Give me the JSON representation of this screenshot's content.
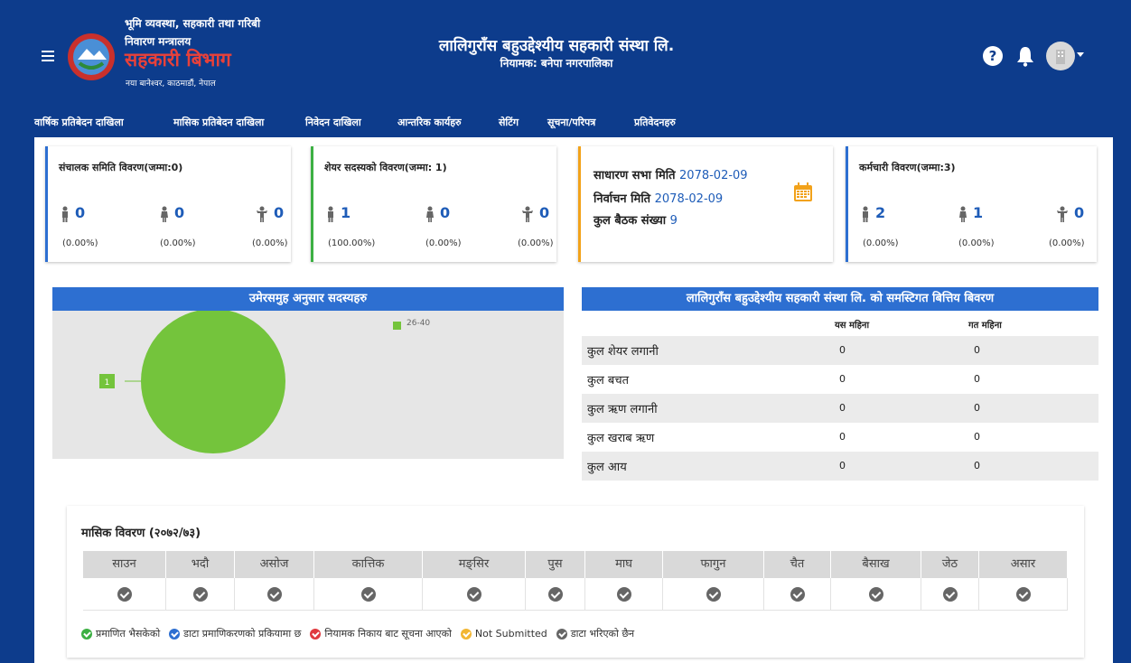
{
  "header": {
    "org_line1": "भूमि व्यवस्था, सहकारी तथा गरिबी",
    "org_line2": "निवारण मन्त्रालय",
    "org_name": "सहकारी बिभाग",
    "org_address": "नया बानेश्वर, काठमाडौं, नेपाल",
    "title": "लालिगुराँस बहुउद्देश्यीय सहकारी संस्था लि.",
    "subtitle": "नियामक: बनेपा नगरपालिका",
    "help_glyph": "?"
  },
  "nav": [
    {
      "label": "वार्षिक प्रतिबेदन दाखिला"
    },
    {
      "label": "मासिक प्रतिबेदन दाखिला"
    },
    {
      "label": "निवेदन दाखिला"
    },
    {
      "label": "आन्तरिक कार्यहरु"
    },
    {
      "label": "सेटिंग"
    },
    {
      "label": "सूचना/परिपत्र"
    },
    {
      "label": "प्रतिवेदनहरु"
    }
  ],
  "cards": {
    "board": {
      "title": "संचालक समिति विवरण(जम्मा:0)",
      "male": "0",
      "female": "0",
      "other": "0",
      "male_pct": "(0.00%)",
      "female_pct": "(0.00%)",
      "other_pct": "(0.00%)"
    },
    "share": {
      "title": "शेयर सदस्यको विवरण(जम्मा: 1)",
      "male": "1",
      "female": "0",
      "other": "0",
      "male_pct": "(100.00%)",
      "female_pct": "(0.00%)",
      "other_pct": "(0.00%)"
    },
    "meeting": {
      "agm_label": "साधारण सभा मिति",
      "agm_date": "2078-02-09",
      "election_label": "निर्वाचन मिति",
      "election_date": "2078-02-09",
      "meetings_label": "कुल बैठक संख्या",
      "meetings_count": "9"
    },
    "staff": {
      "title": "कर्मचारी विवरण(जम्मा:3)",
      "male": "2",
      "female": "1",
      "other": "0",
      "male_pct": "(0.00%)",
      "female_pct": "(0.00%)",
      "other_pct": "(0.00%)"
    }
  },
  "age_panel": {
    "title": "उमेरसमुह अनुसार सदस्यहरु",
    "legend": "26-40",
    "slice_label": "1",
    "slice_color": "#74c43c"
  },
  "chart_data": {
    "type": "pie",
    "categories": [
      "26-40"
    ],
    "values": [
      1
    ],
    "title": "उमेरसमुह अनुसार सदस्यहरु"
  },
  "finance_panel": {
    "title": "लालिगुराँस बहुउद्देश्यीय सहकारी संस्था लि. को समस्टिगत बित्तिय बिवरण",
    "col_this": "यस महिना",
    "col_last": "गत महिना",
    "rows": [
      {
        "label": "कुल शेयर लगानी",
        "this": "0",
        "last": "0"
      },
      {
        "label": "कुल बचत",
        "this": "0",
        "last": "0"
      },
      {
        "label": "कुल ऋण लगानी",
        "this": "0",
        "last": "0"
      },
      {
        "label": "कुल खराब ऋण",
        "this": "0",
        "last": "0"
      },
      {
        "label": "कुल आय",
        "this": "0",
        "last": "0"
      }
    ]
  },
  "monthly": {
    "title": "मासिक विवरण (२०७२/७३)",
    "months": [
      "साउन",
      "भदौ",
      "असोज",
      "कात्तिक",
      "मङ्सिर",
      "पुस",
      "माघ",
      "फागुन",
      "चैत",
      "बैसाख",
      "जेठ",
      "असार"
    ],
    "legend": [
      {
        "label": "प्रमाणित भैसकेको",
        "color": "#3cb043"
      },
      {
        "label": "डाटा प्रमाणिकरणको प्रकियामा छ",
        "color": "#2d6fd1"
      },
      {
        "label": "नियामक निकाय बाट सूचना आएको",
        "color": "#e0393e"
      },
      {
        "label": "Not Submitted",
        "color": "#f2b632"
      },
      {
        "label": "डाटा भरिएको छैन",
        "color": "#666666"
      }
    ]
  },
  "colors": {
    "header_bg": "#0d3c8c",
    "accent": "#2d6fd1",
    "org_name_red": "#e8413a",
    "card_border_board": "#2d6fd1",
    "card_border_share": "#3cb043",
    "card_border_meeting": "#f2a21a",
    "card_border_staff": "#2d6fd1"
  }
}
